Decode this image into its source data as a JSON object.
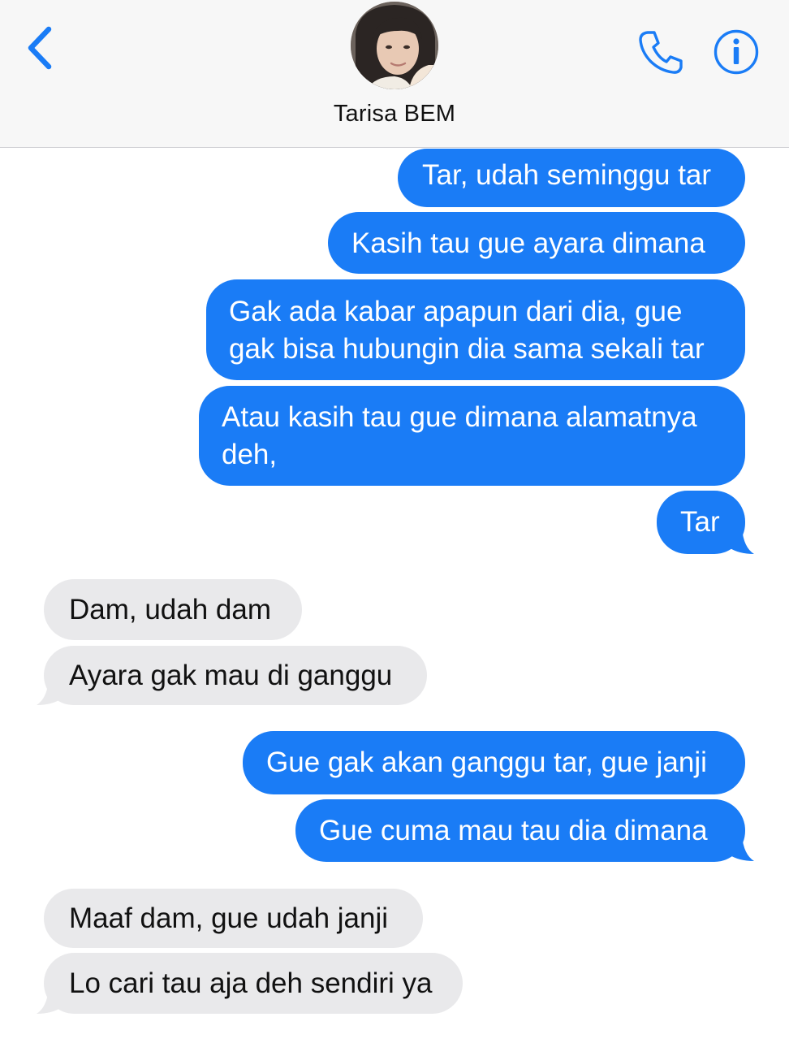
{
  "header": {
    "contact_name": "Tarisa BEM",
    "back_icon": "chevron-left-icon",
    "call_icon": "phone-icon",
    "info_icon": "info-icon",
    "accent_color": "#1a7cf6"
  },
  "messages": [
    {
      "direction": "sent",
      "text": "Tar, udah seminggu tar"
    },
    {
      "direction": "sent",
      "text": "Kasih tau gue ayara dimana"
    },
    {
      "direction": "sent",
      "lines": [
        "Gak ada kabar apapun dari dia, gue",
        "gak bisa hubungin dia sama sekali tar"
      ]
    },
    {
      "direction": "sent",
      "lines": [
        "Atau kasih tau gue dimana alamatnya",
        "deh,"
      ]
    },
    {
      "direction": "sent",
      "text": "Tar"
    },
    {
      "direction": "received",
      "text": "Dam, udah dam"
    },
    {
      "direction": "received",
      "text": "Ayara gak mau di ganggu"
    },
    {
      "direction": "sent",
      "text": "Gue gak akan ganggu tar, gue janji"
    },
    {
      "direction": "sent",
      "text": "Gue cuma mau tau dia dimana"
    },
    {
      "direction": "received",
      "text": "Maaf dam, gue udah janji"
    },
    {
      "direction": "received",
      "text": "Lo cari tau aja deh sendiri ya"
    }
  ]
}
